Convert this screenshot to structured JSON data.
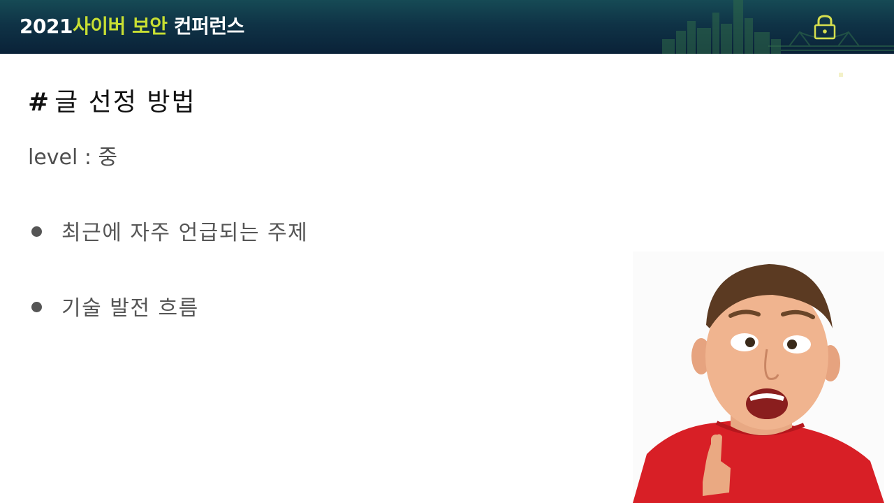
{
  "header": {
    "title_year": "2021",
    "title_cyber": "사이버 보안",
    "title_conference": " 컨퍼런스",
    "accent_color": "#c8df33",
    "icons": [
      "city-skyline-icon",
      "padlock-icon"
    ]
  },
  "slide": {
    "title_hash": "#",
    "title_text": "글 선정 방법",
    "level_text": "level : 중",
    "bullets": [
      "최근에 자주 언급되는 주제",
      "기술 발전 흐름"
    ]
  },
  "image": {
    "subject": "surprised-boy-pointing-up"
  }
}
